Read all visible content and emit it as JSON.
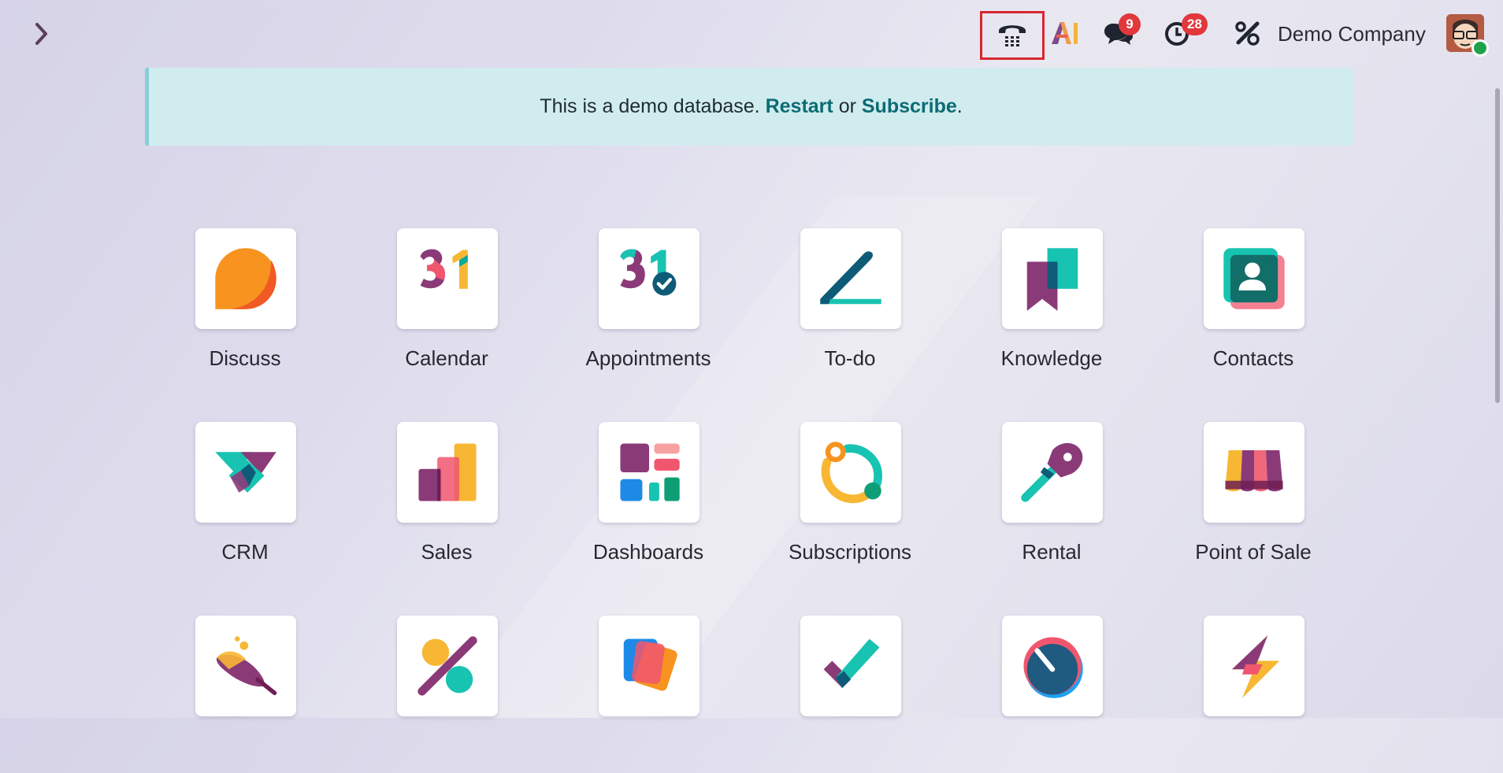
{
  "topbar": {
    "menu_toggle_icon": "chevron-right-icon",
    "phone_icon": "phone-dialpad-icon",
    "ai_icon": "ai-icon",
    "messages_count": "9",
    "activities_count": "28",
    "tools_icon": "tools-icon",
    "company_name": "Demo Company"
  },
  "banner": {
    "text": "This is a demo database.",
    "restart": "Restart",
    "or": "or",
    "subscribe": "Subscribe",
    "period": "."
  },
  "apps": [
    {
      "label": "Discuss",
      "icon": "discuss-icon"
    },
    {
      "label": "Calendar",
      "icon": "calendar-icon"
    },
    {
      "label": "Appointments",
      "icon": "appointments-icon"
    },
    {
      "label": "To-do",
      "icon": "todo-icon"
    },
    {
      "label": "Knowledge",
      "icon": "knowledge-icon"
    },
    {
      "label": "Contacts",
      "icon": "contacts-icon"
    },
    {
      "label": "CRM",
      "icon": "crm-icon"
    },
    {
      "label": "Sales",
      "icon": "sales-icon"
    },
    {
      "label": "Dashboards",
      "icon": "dashboards-icon"
    },
    {
      "label": "Subscriptions",
      "icon": "subscriptions-icon"
    },
    {
      "label": "Rental",
      "icon": "rental-icon"
    },
    {
      "label": "Point of Sale",
      "icon": "point-of-sale-icon"
    }
  ],
  "colors": {
    "badge": "#e0383c",
    "highlight_border": "#d9262f",
    "banner_bg": "#d1ecef",
    "link": "#0c6b73"
  }
}
